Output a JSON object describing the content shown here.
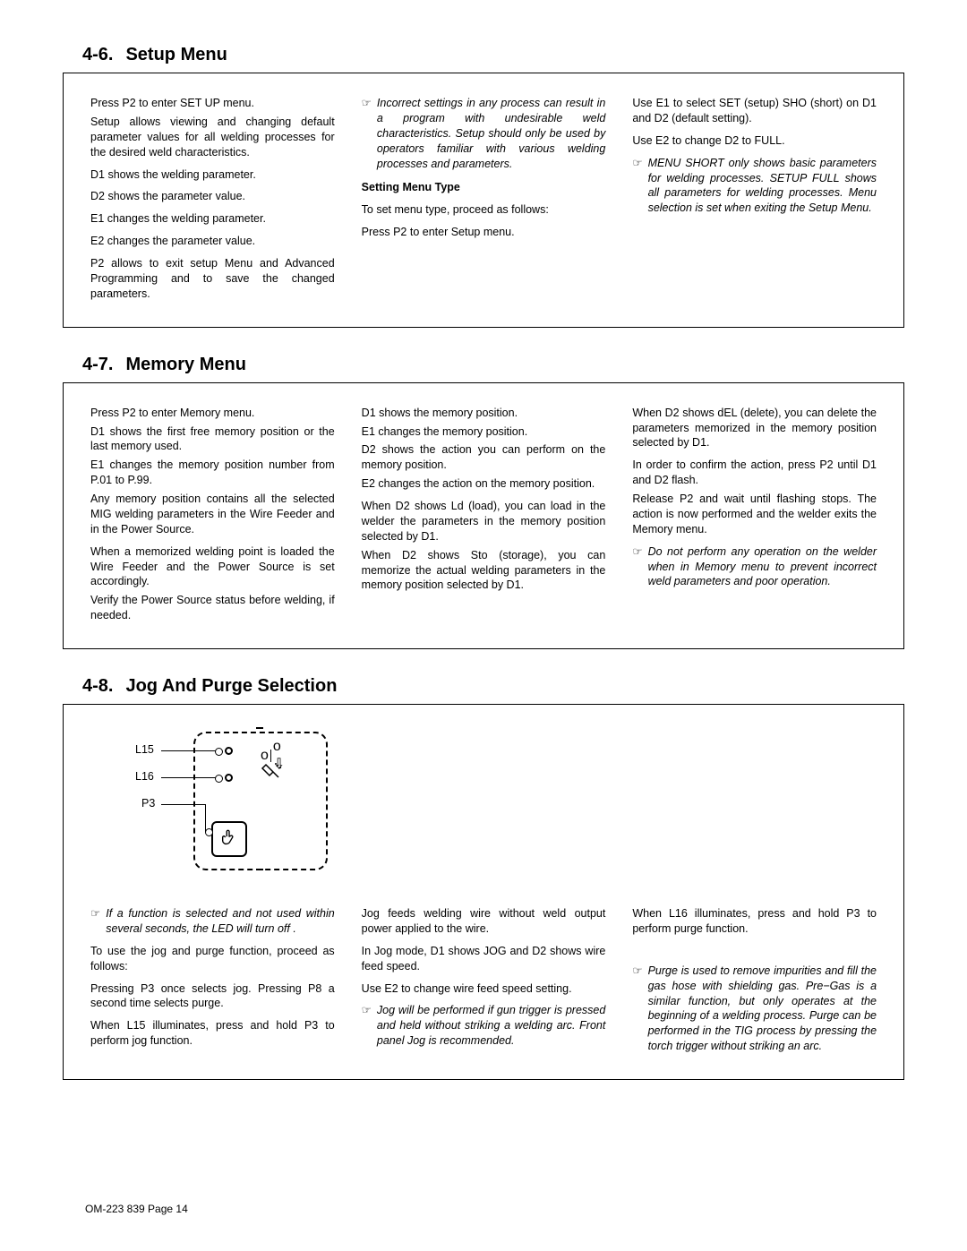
{
  "sec46": {
    "num": "4-6.",
    "title": "Setup Menu",
    "c1": {
      "p1": "Press P2 to enter SET UP menu.",
      "p2": "Setup allows viewing and changing default parameter values for all welding processes for the desired weld characteristics.",
      "p3": "D1 shows the welding parameter.",
      "p4": "D2 shows the parameter value.",
      "p5": "E1 changes the welding parameter.",
      "p6": "E2 changes the parameter value.",
      "p7": "P2 allows to exit setup Menu and Advanced Programming and to save the changed parameters."
    },
    "c2": {
      "n1": "Incorrect settings in any process can result in a program with undesirable weld characteristics. Setup should only be used by operators familiar with various welding processes and parameters.",
      "h1": "Setting Menu Type",
      "p1": "To set menu type, proceed as follows:",
      "p2": "Press P2 to enter Setup menu."
    },
    "c3": {
      "p1": "Use E1 to select SET (setup) SHO (short) on D1 and D2 (default setting).",
      "p2": "Use E2 to change D2 to FULL.",
      "n1": "MENU SHORT only shows basic parameters for welding processes. SETUP FULL shows all parameters for welding processes. Menu selection is set when exiting the Setup Menu."
    }
  },
  "sec47": {
    "num": "4-7.",
    "title": "Memory Menu",
    "c1": {
      "p1": "Press P2 to enter Memory menu.",
      "p2": "D1 shows the first free memory position or the last memory used.",
      "p3": "E1 changes the memory position number from P.01 to P.99.",
      "p4": "Any memory position contains all the selected MIG welding parameters in the Wire Feeder and in the Power Source.",
      "p5": "When a memorized welding point is loaded the Wire Feeder and the Power Source is set accordingly.",
      "p6": "Verify the Power Source status before welding, if needed."
    },
    "c2": {
      "p1": "D1 shows the memory position.",
      "p2": "E1 changes the memory position.",
      "p3": "D2 shows the action you can perform on the memory position.",
      "p4": "E2 changes the action on the memory position.",
      "p5": "When D2 shows Ld (load), you can load in the welder the parameters in the memory position selected by D1.",
      "p6": "When D2 shows Sto (storage), you can memorize the actual welding parameters in the memory position selected by D1."
    },
    "c3": {
      "p1": "When D2 shows dEL (delete), you can delete the parameters memorized in the memory position selected by D1.",
      "p2": "In order to confirm the action, press P2 until D1 and D2 flash.",
      "p3": "Release P2 and wait until flashing stops. The action is now performed and the welder exits the Memory menu.",
      "n1": "Do not perform any operation on the welder when in Memory menu to prevent incorrect weld parameters and poor operation."
    }
  },
  "sec48": {
    "num": "4-8.",
    "title": "Jog And Purge Selection",
    "labels": {
      "l15": "L15",
      "l16": "L16",
      "p3": "P3"
    },
    "c1": {
      "n1": "If a function is selected and not used within several seconds, the LED will turn off .",
      "p1": "To use the jog and purge function, proceed as follows:",
      "p2": "Pressing P3 once selects jog. Pressing P8 a second time selects purge.",
      "p3": "When L15 illuminates, press and hold P3 to perform jog function."
    },
    "c2": {
      "p1": "Jog feeds welding wire without weld output power applied to the wire.",
      "p2": "In Jog mode, D1 shows JOG and D2 shows wire feed speed.",
      "p3": "Use E2 to change wire feed speed setting.",
      "n1": "Jog will be performed if gun trigger is pressed and held without striking a welding arc. Front panel Jog is recommended."
    },
    "c3": {
      "p1": "When L16 illuminates, press and hold P3 to perform purge function.",
      "n1": "Purge is used to remove impurities and fill the gas hose with shielding gas. Pre−Gas is a similar function, but only operates at the beginning of a welding process. Purge can be performed in the TIG process by pressing the torch trigger without striking an arc."
    }
  },
  "footer": "OM-223 839 Page 14",
  "noteIcon": "☞"
}
